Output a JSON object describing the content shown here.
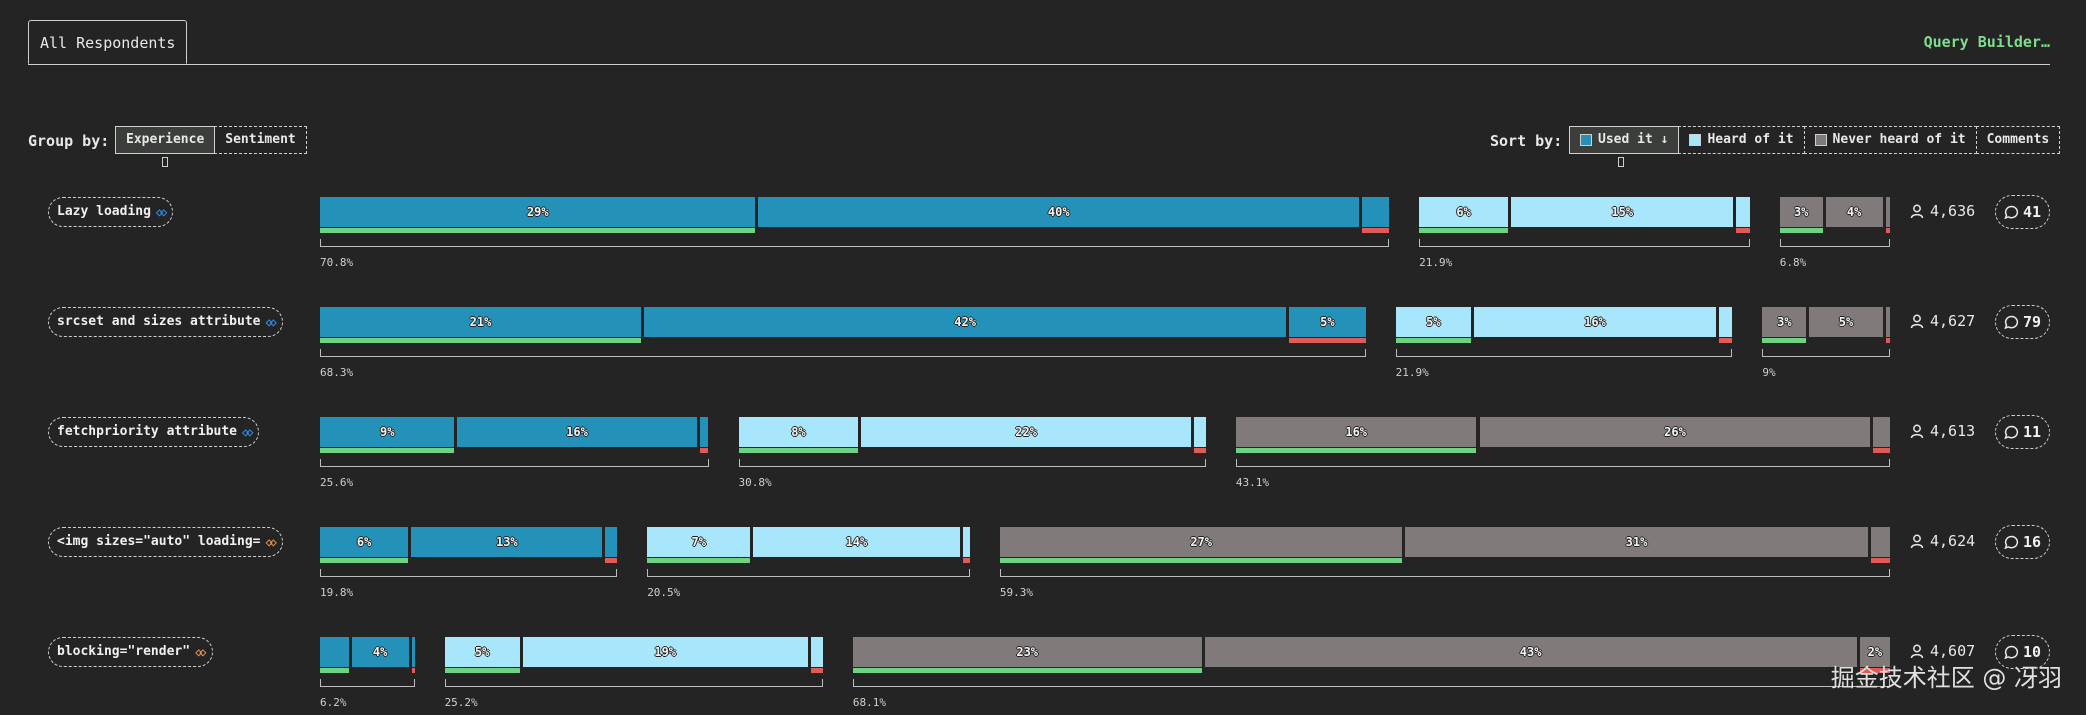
{
  "tabs": {
    "active": "All Respondents",
    "query_builder": "Query Builder…"
  },
  "controls": {
    "group_by": {
      "label": "Group by:",
      "options": [
        "Experience",
        "Sentiment"
      ],
      "active": "Experience"
    },
    "sort_by": {
      "label": "Sort by:",
      "options": [
        "Used it ↓",
        "Heard of it",
        "Never heard of it",
        "Comments"
      ],
      "active": "Used it ↓"
    }
  },
  "colors": {
    "used_it": "#2492b8",
    "heard_of_it": "#a8e6fb",
    "never_heard": "#807a7a",
    "positive": "#6ed283",
    "negative": "#e05a56"
  },
  "watermark": "掘金技术社区 @ 冴羽",
  "chart_data": {
    "type": "bar",
    "stacked": true,
    "groups": [
      "Used it",
      "Heard of it",
      "Never heard of it"
    ],
    "rows": [
      {
        "feature": "Lazy loading",
        "icon": "baseline-widely-available-icon",
        "respondents": "4,636",
        "comments": "41",
        "groups": [
          {
            "group": "Used it",
            "total": "70.8%",
            "segments": [
              {
                "sentiment": "positive",
                "value": 29,
                "label": "29%"
              },
              {
                "sentiment": "neutral",
                "value": 40,
                "label": "40%"
              },
              {
                "sentiment": "negative",
                "value": 1.8,
                "label": ""
              }
            ]
          },
          {
            "group": "Heard of it",
            "total": "21.9%",
            "segments": [
              {
                "sentiment": "positive",
                "value": 6,
                "label": "6%"
              },
              {
                "sentiment": "neutral",
                "value": 15,
                "label": "15%"
              },
              {
                "sentiment": "negative",
                "value": 0.9,
                "label": ""
              }
            ]
          },
          {
            "group": "Never heard of it",
            "total": "6.8%",
            "segments": [
              {
                "sentiment": "positive",
                "value": 3,
                "label": "3%"
              },
              {
                "sentiment": "neutral",
                "value": 4,
                "label": "4%"
              },
              {
                "sentiment": "negative",
                "value": 0.3,
                "label": ""
              }
            ]
          }
        ]
      },
      {
        "feature": "srcset and sizes attribute",
        "icon": "baseline-widely-available-icon",
        "respondents": "4,627",
        "comments": "79",
        "groups": [
          {
            "group": "Used it",
            "total": "68.3%",
            "segments": [
              {
                "sentiment": "positive",
                "value": 21,
                "label": "21%"
              },
              {
                "sentiment": "neutral",
                "value": 42,
                "label": "42%"
              },
              {
                "sentiment": "negative",
                "value": 5,
                "label": "5%"
              }
            ]
          },
          {
            "group": "Heard of it",
            "total": "21.9%",
            "segments": [
              {
                "sentiment": "positive",
                "value": 5,
                "label": "5%"
              },
              {
                "sentiment": "neutral",
                "value": 16,
                "label": "16%"
              },
              {
                "sentiment": "negative",
                "value": 0.9,
                "label": ""
              }
            ]
          },
          {
            "group": "Never heard of it",
            "total": "9%",
            "segments": [
              {
                "sentiment": "positive",
                "value": 3,
                "label": "3%"
              },
              {
                "sentiment": "neutral",
                "value": 5,
                "label": "5%"
              },
              {
                "sentiment": "negative",
                "value": 0.3,
                "label": ""
              }
            ]
          }
        ]
      },
      {
        "feature": "fetchpriority attribute",
        "icon": "baseline-widely-available-icon",
        "respondents": "4,613",
        "comments": "11",
        "groups": [
          {
            "group": "Used it",
            "total": "25.6%",
            "segments": [
              {
                "sentiment": "positive",
                "value": 9,
                "label": "9%"
              },
              {
                "sentiment": "neutral",
                "value": 16,
                "label": "16%"
              },
              {
                "sentiment": "negative",
                "value": 0.6,
                "label": ""
              }
            ]
          },
          {
            "group": "Heard of it",
            "total": "30.8%",
            "segments": [
              {
                "sentiment": "positive",
                "value": 8,
                "label": "8%"
              },
              {
                "sentiment": "neutral",
                "value": 22,
                "label": "22%"
              },
              {
                "sentiment": "negative",
                "value": 0.8,
                "label": ""
              }
            ]
          },
          {
            "group": "Never heard of it",
            "total": "43.1%",
            "segments": [
              {
                "sentiment": "positive",
                "value": 16,
                "label": "16%"
              },
              {
                "sentiment": "neutral",
                "value": 26,
                "label": "26%"
              },
              {
                "sentiment": "negative",
                "value": 1.1,
                "label": ""
              }
            ]
          }
        ]
      },
      {
        "feature": "<img sizes=\"auto\" loading=",
        "icon": "baseline-limited-availability-icon",
        "respondents": "4,624",
        "comments": "16",
        "groups": [
          {
            "group": "Used it",
            "total": "19.8%",
            "segments": [
              {
                "sentiment": "positive",
                "value": 6,
                "label": "6%"
              },
              {
                "sentiment": "neutral",
                "value": 13,
                "label": "13%"
              },
              {
                "sentiment": "negative",
                "value": 0.8,
                "label": ""
              }
            ]
          },
          {
            "group": "Heard of it",
            "total": "20.5%",
            "segments": [
              {
                "sentiment": "positive",
                "value": 7,
                "label": "7%"
              },
              {
                "sentiment": "neutral",
                "value": 14,
                "label": "14%"
              },
              {
                "sentiment": "negative",
                "value": 0.5,
                "label": ""
              }
            ]
          },
          {
            "group": "Never heard of it",
            "total": "59.3%",
            "segments": [
              {
                "sentiment": "positive",
                "value": 27,
                "label": "27%"
              },
              {
                "sentiment": "neutral",
                "value": 31,
                "label": "31%"
              },
              {
                "sentiment": "negative",
                "value": 1.3,
                "label": ""
              }
            ]
          }
        ]
      },
      {
        "feature": "blocking=\"render\"",
        "icon": "baseline-limited-availability-icon",
        "respondents": "4,607",
        "comments": "10",
        "groups": [
          {
            "group": "Used it",
            "total": "6.2%",
            "segments": [
              {
                "sentiment": "positive",
                "value": 2,
                "label": ""
              },
              {
                "sentiment": "neutral",
                "value": 4,
                "label": "4%"
              },
              {
                "sentiment": "negative",
                "value": 0.2,
                "label": ""
              }
            ]
          },
          {
            "group": "Heard of it",
            "total": "25.2%",
            "segments": [
              {
                "sentiment": "positive",
                "value": 5,
                "label": "5%"
              },
              {
                "sentiment": "neutral",
                "value": 19,
                "label": "19%"
              },
              {
                "sentiment": "negative",
                "value": 0.8,
                "label": ""
              }
            ]
          },
          {
            "group": "Never heard of it",
            "total": "68.1%",
            "segments": [
              {
                "sentiment": "positive",
                "value": 23,
                "label": "23%"
              },
              {
                "sentiment": "neutral",
                "value": 43,
                "label": "43%"
              },
              {
                "sentiment": "negative",
                "value": 2,
                "label": "2%"
              }
            ]
          }
        ]
      }
    ]
  }
}
